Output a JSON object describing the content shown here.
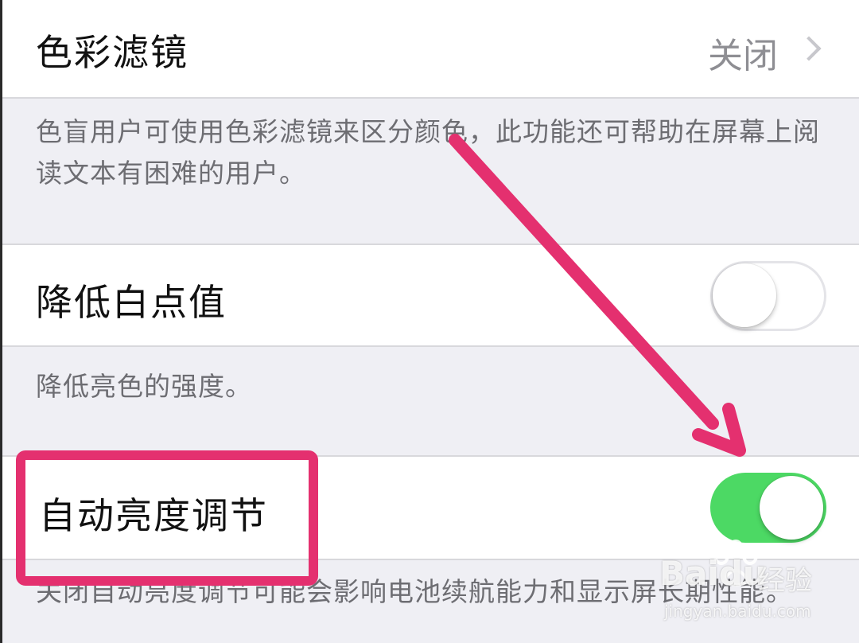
{
  "settings": {
    "color_filters": {
      "label": "色彩滤镜",
      "value": "关闭",
      "footer": "色盲用户可使用色彩滤镜来区分颜色，此功能还可帮助在屏幕上阅读文本有困难的用户。"
    },
    "reduce_white_point": {
      "label": "降低白点值",
      "toggle_on": false,
      "footer": "降低亮色的强度。"
    },
    "auto_brightness": {
      "label": "自动亮度调节",
      "toggle_on": true,
      "footer": "关闭自动亮度调节可能会影响电池续航能力和显示屏长期性能。"
    }
  },
  "annotation": {
    "highlight_color": "#e4306f",
    "arrow_color": "#e4306f"
  },
  "watermark": {
    "brand": "Baidu",
    "service": "经验",
    "url": "jingyan.baidu.com"
  },
  "colors": {
    "toggle_on": "#4cd964",
    "group_background": "#efeff4",
    "cell_background": "#ffffff"
  }
}
